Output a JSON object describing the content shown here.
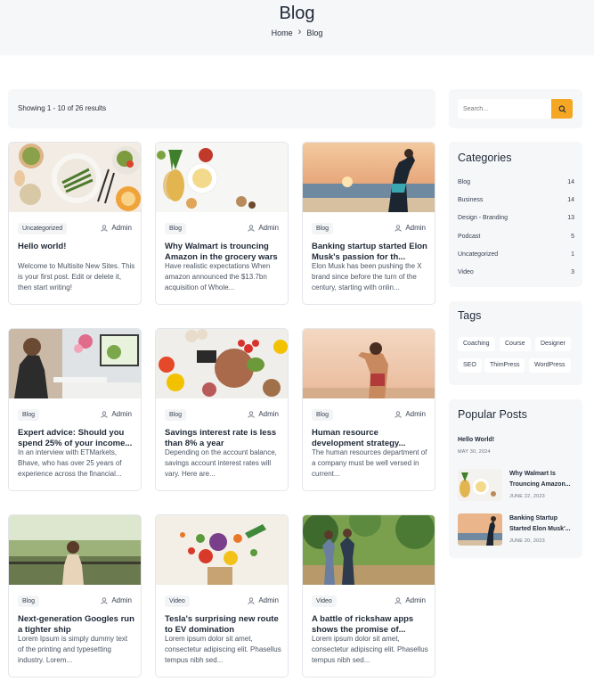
{
  "header": {
    "title": "Blog",
    "breadcrumb": {
      "home": "Home",
      "current": "Blog"
    }
  },
  "results": {
    "text": "Showing 1 - 10 of 26 results"
  },
  "posts": [
    {
      "tag": "Uncategorized",
      "author": "Admin",
      "title": "Hello world!",
      "excerpt": "Welcome to Multisite New Sites. This is your first post. Edit or delete it, then start writing!"
    },
    {
      "tag": "Blog",
      "author": "Admin",
      "title": "Why Walmart is trouncing Amazon in the grocery wars",
      "excerpt": "Have realistic expectations When amazon announced the $13.7bn acquisition of Whole..."
    },
    {
      "tag": "Blog",
      "author": "Admin",
      "title": "Banking startup started Elon Musk's passion for th...",
      "excerpt": "Elon Musk has been pushing the X brand since before the turn of the century, starting with onlin..."
    },
    {
      "tag": "Blog",
      "author": "Admin",
      "title": "Expert advice: Should you spend 25% of your income...",
      "excerpt": "In an interview with ETMarkets, Bhave, who has over 25 years of experience across the financial..."
    },
    {
      "tag": "Blog",
      "author": "Admin",
      "title": "Savings interest rate is less than 8% a year",
      "excerpt": "Depending on the account balance, savings account interest rates will vary. Here are..."
    },
    {
      "tag": "Blog",
      "author": "Admin",
      "title": "Human resource development strategy...",
      "excerpt": "The human resources department of a company must be well versed in current..."
    },
    {
      "tag": "Blog",
      "author": "Admin",
      "title": "Next-generation Googles run a tighter ship",
      "excerpt": "Lorem Ipsum is simply dummy text of the printing and typesetting industry. Lorem..."
    },
    {
      "tag": "Video",
      "author": "Admin",
      "title": "Tesla's surprising new route to EV domination",
      "excerpt": "Lorem ipsum dolor sit amet, consectetur adipiscing elit. Phasellus tempus nibh sed..."
    },
    {
      "tag": "Video",
      "author": "Admin",
      "title": "A battle of rickshaw apps shows the promise of...",
      "excerpt": "Lorem ipsum dolor sit amet, consectetur adipiscing elit. Phasellus tempus nibh sed..."
    }
  ],
  "sidebar": {
    "search": {
      "placeholder": "Search..."
    },
    "categories": {
      "title": "Categories",
      "items": [
        {
          "label": "Blog",
          "count": "14"
        },
        {
          "label": "Business",
          "count": "14"
        },
        {
          "label": "Design - Branding",
          "count": "13"
        },
        {
          "label": "Podcast",
          "count": "5"
        },
        {
          "label": "Uncategorized",
          "count": "1"
        },
        {
          "label": "Video",
          "count": "3"
        }
      ]
    },
    "tags": {
      "title": "Tags",
      "items": [
        "Coaching",
        "Course",
        "Designer",
        "SEO",
        "ThimPress",
        "WordPress"
      ]
    },
    "popular": {
      "title": "Popular Posts",
      "items": [
        {
          "title": "Hello World!",
          "date": "MAY 30, 2024"
        },
        {
          "title": "Why Walmart Is Trouncing Amazon...",
          "date": "JUNE 22, 2023"
        },
        {
          "title": "Banking Startup Started Elon Musk'...",
          "date": "JUNE 20, 2023"
        }
      ]
    }
  },
  "colors": {
    "accent": "#f5a623",
    "panel": "#f6f7f9",
    "border": "#e3e6ea"
  }
}
